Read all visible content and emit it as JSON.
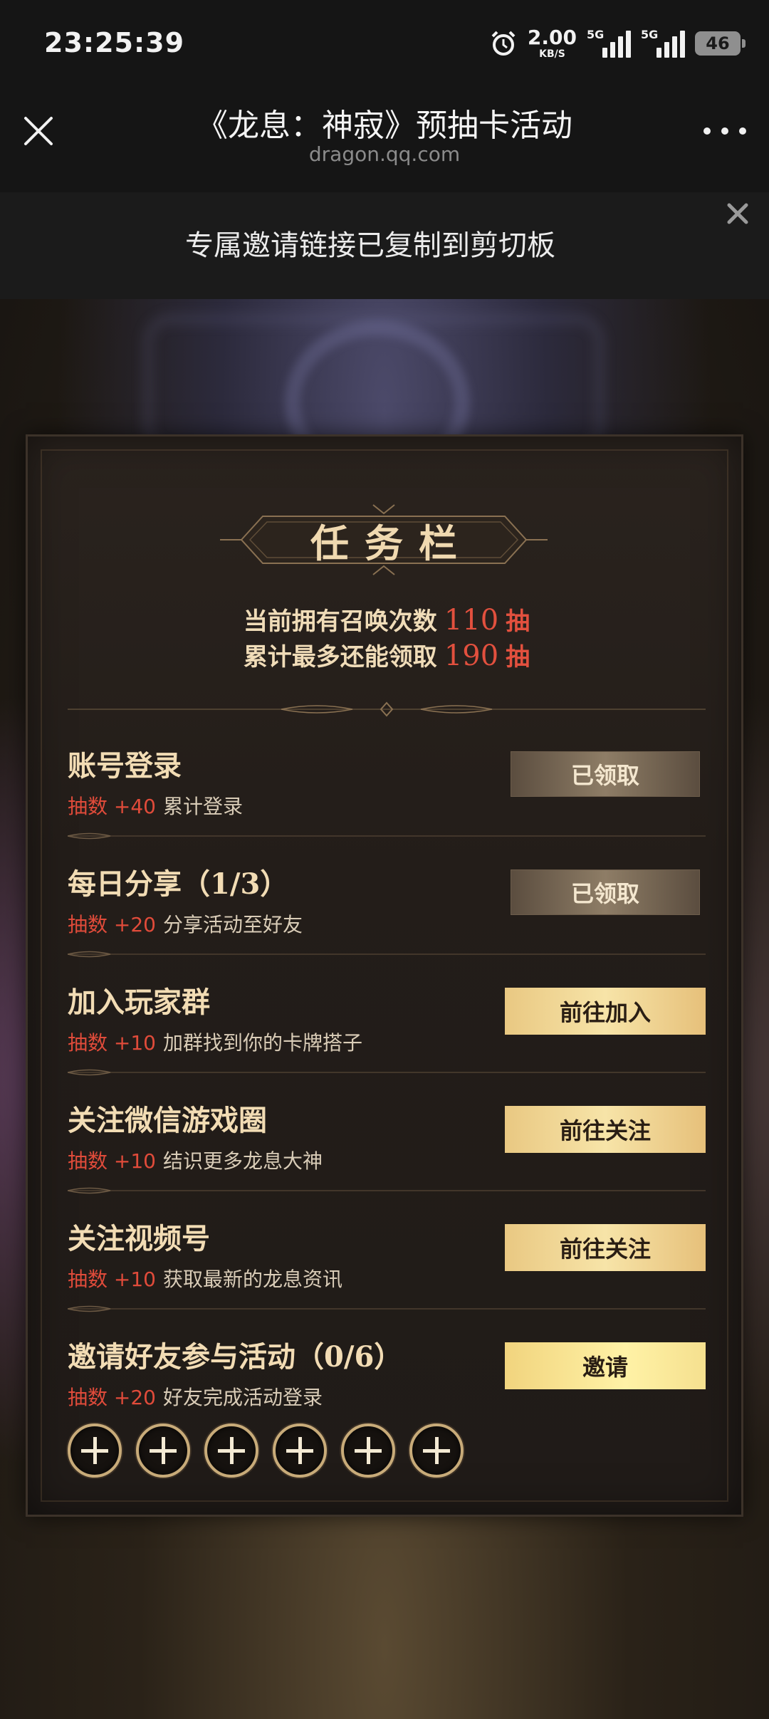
{
  "status_bar": {
    "time": "23:25:39",
    "net_speed": "2.00",
    "net_unit": "KB/S",
    "sim1_label": "5G",
    "sim2_label": "5G",
    "battery": "46"
  },
  "nav": {
    "title": "《龙息：神寂》预抽卡活动",
    "subtitle": "dragon.qq.com"
  },
  "toast": {
    "message": "专属邀请链接已复制到剪切板"
  },
  "panel": {
    "title": "任务栏",
    "summary_line1_label": "当前拥有召唤次数",
    "summary_line1_value": "110",
    "summary_line2_label": "累计最多还能领取",
    "summary_line2_value": "190",
    "unit": "抽"
  },
  "tasks": [
    {
      "title": "账号登录",
      "points": "抽数 +40",
      "desc": "累计登录",
      "button": "已领取"
    },
    {
      "title": "每日分享（1/3）",
      "points": "抽数 +20",
      "desc": "分享活动至好友",
      "button": "已领取"
    },
    {
      "title": "加入玩家群",
      "points": "抽数 +10",
      "desc": "加群找到你的卡牌搭子",
      "button": "前往加入"
    },
    {
      "title": "关注微信游戏圈",
      "points": "抽数 +10",
      "desc": "结识更多龙息大神",
      "button": "前往关注"
    },
    {
      "title": "关注视频号",
      "points": "抽数 +10",
      "desc": "获取最新的龙息资讯",
      "button": "前往关注"
    },
    {
      "title": "邀请好友参与活动（0/6）",
      "points": "抽数 +20",
      "desc": "好友完成活动登录",
      "button": "邀请"
    }
  ],
  "invite_slots": 6,
  "colors": {
    "highlight_red": "#e2503e",
    "gold_text": "#f0dcb8",
    "button_gold": "#f7e4a8"
  }
}
